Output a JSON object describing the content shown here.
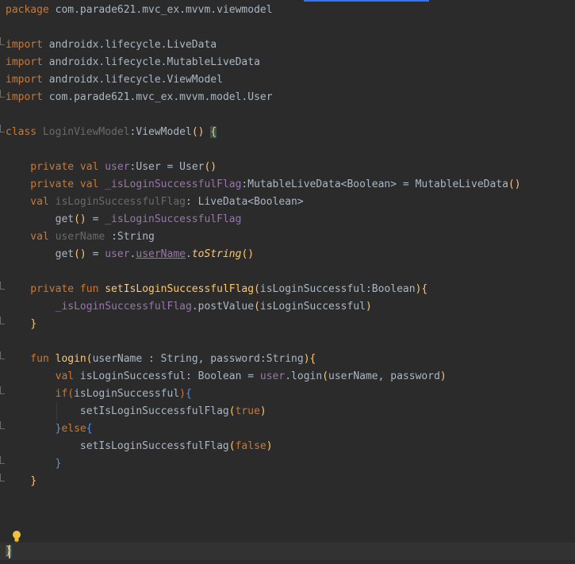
{
  "editor": {
    "code_lines": [
      {
        "tokens": [
          {
            "t": "package ",
            "c": "kw"
          },
          {
            "t": "com.parade621.mvc_ex.mvvm.viewmodel",
            "c": "pl"
          }
        ]
      },
      {
        "tokens": []
      },
      {
        "tokens": [
          {
            "t": "import ",
            "c": "kw"
          },
          {
            "t": "androidx.lifecycle.LiveData",
            "c": "pl"
          }
        ]
      },
      {
        "tokens": [
          {
            "t": "import ",
            "c": "kw"
          },
          {
            "t": "androidx.lifecycle.MutableLiveData",
            "c": "pl"
          }
        ]
      },
      {
        "tokens": [
          {
            "t": "import ",
            "c": "kw"
          },
          {
            "t": "androidx.lifecycle.ViewModel",
            "c": "pl"
          }
        ]
      },
      {
        "tokens": [
          {
            "t": "import ",
            "c": "kw"
          },
          {
            "t": "com.parade621.mvc_ex.mvvm.model.User",
            "c": "pl"
          }
        ]
      },
      {
        "tokens": []
      },
      {
        "tokens": [
          {
            "t": "class ",
            "c": "kw"
          },
          {
            "t": "LoginViewModel",
            "c": "decl"
          },
          {
            "t": ":ViewModel",
            "c": "pl"
          },
          {
            "t": "()",
            "c": "br1"
          },
          {
            "t": " ",
            "c": "pl"
          },
          {
            "t": "{",
            "c": "brY"
          }
        ]
      },
      {
        "tokens": []
      },
      {
        "tokens": [
          {
            "t": "    private val ",
            "c": "kw"
          },
          {
            "t": "user",
            "c": "prop"
          },
          {
            "t": ":User = User",
            "c": "pl"
          },
          {
            "t": "()",
            "c": "br1"
          }
        ]
      },
      {
        "tokens": [
          {
            "t": "    private val ",
            "c": "kw"
          },
          {
            "t": "_isLoginSuccessfulFlag",
            "c": "prop"
          },
          {
            "t": ":MutableLiveData<Boolean> = MutableLiveData",
            "c": "pl"
          },
          {
            "t": "()",
            "c": "br1"
          }
        ]
      },
      {
        "tokens": [
          {
            "t": "    val ",
            "c": "kw"
          },
          {
            "t": "isLoginSuccessfulFlag",
            "c": "decl"
          },
          {
            "t": ": LiveData<Boolean>",
            "c": "pl"
          }
        ]
      },
      {
        "tokens": [
          {
            "t": "        get",
            "c": "pl"
          },
          {
            "t": "()",
            "c": "br1"
          },
          {
            "t": " = ",
            "c": "pl"
          },
          {
            "t": "_isLoginSuccessfulFlag",
            "c": "prop"
          }
        ]
      },
      {
        "tokens": [
          {
            "t": "    val ",
            "c": "kw"
          },
          {
            "t": "userName",
            "c": "decl"
          },
          {
            "t": " :String",
            "c": "pl"
          }
        ]
      },
      {
        "tokens": [
          {
            "t": "        get",
            "c": "pl"
          },
          {
            "t": "()",
            "c": "br1"
          },
          {
            "t": " = ",
            "c": "pl"
          },
          {
            "t": "user",
            "c": "prop"
          },
          {
            "t": ".",
            "c": "pl"
          },
          {
            "t": "userName",
            "c": "prop",
            "u": true
          },
          {
            "t": ".",
            "c": "pl"
          },
          {
            "t": "toString",
            "c": "fnit"
          },
          {
            "t": "()",
            "c": "br1"
          }
        ]
      },
      {
        "tokens": []
      },
      {
        "tokens": [
          {
            "t": "    private fun ",
            "c": "kw"
          },
          {
            "t": "setIsLoginSuccessfulFlag",
            "c": "fn"
          },
          {
            "t": "(",
            "c": "br1"
          },
          {
            "t": "isLoginSuccessful:Boolean",
            "c": "pl"
          },
          {
            "t": ")",
            "c": "br1"
          },
          {
            "t": "{",
            "c": "br1"
          }
        ]
      },
      {
        "tokens": [
          {
            "t": "        ",
            "c": "pl"
          },
          {
            "t": "_isLoginSuccessfulFlag",
            "c": "prop"
          },
          {
            "t": ".postValue",
            "c": "pl"
          },
          {
            "t": "(",
            "c": "br1"
          },
          {
            "t": "isLoginSuccessful",
            "c": "pl"
          },
          {
            "t": ")",
            "c": "br1"
          }
        ]
      },
      {
        "tokens": [
          {
            "t": "    ",
            "c": "pl"
          },
          {
            "t": "}",
            "c": "br1"
          }
        ]
      },
      {
        "tokens": []
      },
      {
        "tokens": [
          {
            "t": "    fun ",
            "c": "kw"
          },
          {
            "t": "login",
            "c": "fn"
          },
          {
            "t": "(",
            "c": "br1"
          },
          {
            "t": "userName : String, password:String",
            "c": "pl"
          },
          {
            "t": ")",
            "c": "br1"
          },
          {
            "t": "{",
            "c": "br1"
          }
        ]
      },
      {
        "tokens": [
          {
            "t": "        val ",
            "c": "kw"
          },
          {
            "t": "isLoginSuccessful: Boolean = ",
            "c": "pl"
          },
          {
            "t": "user",
            "c": "prop"
          },
          {
            "t": ".login",
            "c": "pl"
          },
          {
            "t": "(",
            "c": "br1"
          },
          {
            "t": "userName, password",
            "c": "pl"
          },
          {
            "t": ")",
            "c": "br1"
          }
        ]
      },
      {
        "tokens": [
          {
            "t": "        if",
            "c": "kw"
          },
          {
            "t": "(",
            "c": "br2"
          },
          {
            "t": "isLoginSuccessful",
            "c": "pl"
          },
          {
            "t": ")",
            "c": "br2"
          },
          {
            "t": "{",
            "c": "brB"
          }
        ]
      },
      {
        "tokens": [
          {
            "t": "            setIsLoginSuccessfulFlag",
            "c": "pl"
          },
          {
            "t": "(",
            "c": "br1"
          },
          {
            "t": "true",
            "c": "kw"
          },
          {
            "t": ")",
            "c": "br1"
          }
        ]
      },
      {
        "tokens": [
          {
            "t": "        ",
            "c": "pl"
          },
          {
            "t": "}",
            "c": "brB"
          },
          {
            "t": "else",
            "c": "kw"
          },
          {
            "t": "{",
            "c": "brB"
          }
        ]
      },
      {
        "tokens": [
          {
            "t": "            setIsLoginSuccessfulFlag",
            "c": "pl"
          },
          {
            "t": "(",
            "c": "br1"
          },
          {
            "t": "false",
            "c": "kw"
          },
          {
            "t": ")",
            "c": "br1"
          }
        ]
      },
      {
        "tokens": [
          {
            "t": "        ",
            "c": "pl"
          },
          {
            "t": "}",
            "c": "brB"
          }
        ]
      },
      {
        "tokens": [
          {
            "t": "    ",
            "c": "pl"
          },
          {
            "t": "}",
            "c": "br1"
          }
        ]
      },
      {
        "tokens": []
      },
      {
        "tokens": []
      },
      {
        "tokens": []
      },
      {
        "tokens": [
          {
            "t": "}",
            "c": "brY"
          }
        ]
      }
    ]
  }
}
